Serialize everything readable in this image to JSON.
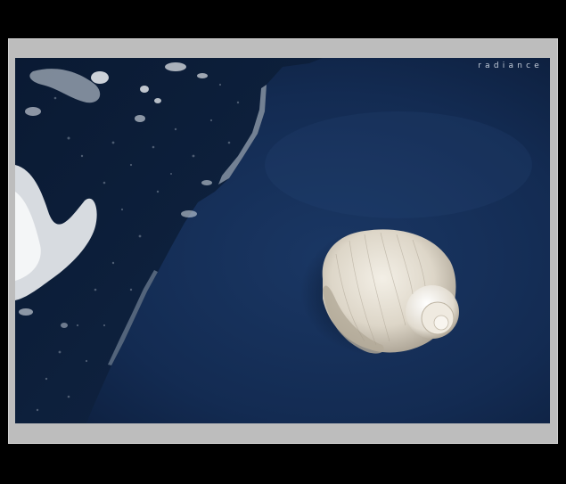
{
  "photo": {
    "watermark": "radiance",
    "subject_colors": {
      "water": "#132b52",
      "water_deep": "#0d1f3d",
      "foam": "#e9ecef",
      "shell": "#e6e1d7",
      "frame": "#bdbdbd",
      "background": "#000000"
    }
  }
}
